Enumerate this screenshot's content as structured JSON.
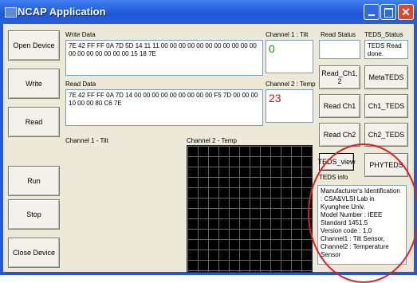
{
  "window": {
    "title": "NCAP Application"
  },
  "left_buttons": {
    "open_device": "Open Device",
    "write": "Write",
    "read": "Read",
    "run": "Run",
    "stop": "Stop",
    "close_device": "Close Device"
  },
  "write_data": {
    "label": "Write Data",
    "value": "7E 42 FF FF 0A 7D 5D 14 11 11 00 00 00 00 00 00 00 00 00 00 00 00 00 00 00 00 00 00 15 18 7E"
  },
  "read_data": {
    "label": "Read Data",
    "value": "7E 42 FF FF 0A  7D 14 00 00 00 00 00 00 00 00 00 F5  7D 00 00 00 10 00 00 80 C6 7E"
  },
  "channel1": {
    "label": "Channel 1 : Tilt",
    "value": "0"
  },
  "channel2": {
    "label": "Channel 2 : Temp",
    "value": "23"
  },
  "plot_labels": {
    "channel1": "Channel 1 - Tilt",
    "channel2": "Channel 2 - Temp"
  },
  "read_status": {
    "label": "Read Status",
    "value": ""
  },
  "teds_status": {
    "label": "TEDS_Status",
    "value": "TEDS Read done."
  },
  "right_buttons": {
    "read_ch12": "Read_Ch1, 2",
    "meta_teds": "MetaTEDS",
    "read_ch1": "Read Ch1",
    "ch1_teds": "Ch1_TEDS",
    "read_ch2": "Read Ch2",
    "ch2_teds": "Ch2_TEDS",
    "teds_view": "TEDS_view",
    "phy_teds": "PHYTEDS"
  },
  "teds_info": {
    "label": "TEDS info",
    "lines": "Manufacturer's Identification : CSA&VLSI Lab in Kyunghee Univ.",
    "model": "Model Number : IEEE Standard 1451.5",
    "version": "Version code : 1.0",
    "ch1": "Channel1 : Tilt Sensor,",
    "ch2": "Channel2 : Temperature Sensor"
  }
}
